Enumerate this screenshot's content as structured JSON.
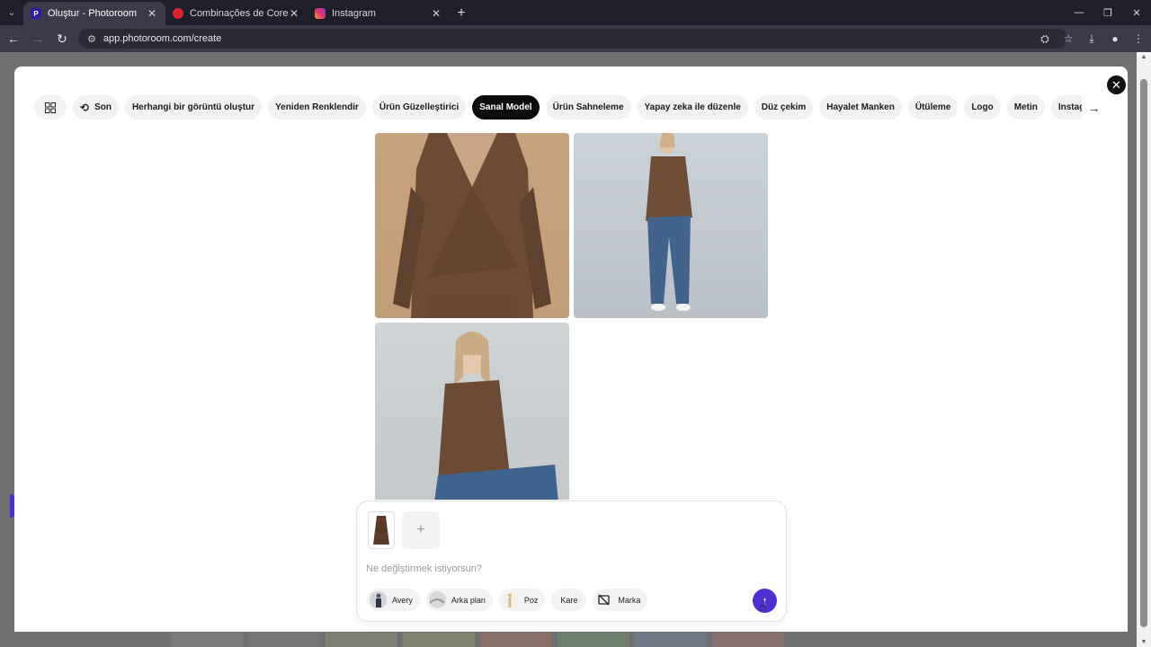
{
  "browser": {
    "tabs": [
      {
        "title": "Oluştur - Photoroom",
        "favicon_color": "#2b1fa0",
        "active": true
      },
      {
        "title": "Combinações de Cores - Outo",
        "favicon_color": "#d8232a",
        "active": false
      },
      {
        "title": "Instagram",
        "favicon_color": "#e1306c",
        "active": false
      }
    ],
    "url": "app.photoroom.com/create"
  },
  "modal": {
    "close_label": "✕",
    "chips": [
      {
        "label": "",
        "icon": "grid-icon",
        "active": false
      },
      {
        "label": "Son",
        "icon": "history-icon",
        "active": false
      },
      {
        "label": "Herhangi bir görüntü oluştur",
        "active": false
      },
      {
        "label": "Yeniden Renklendir",
        "active": false
      },
      {
        "label": "Ürün Güzelleştirici",
        "active": false
      },
      {
        "label": "Sanal Model",
        "active": true
      },
      {
        "label": "Ürün Sahneleme",
        "active": false
      },
      {
        "label": "Yapay zeka ile düzenle",
        "active": false
      },
      {
        "label": "Düz çekim",
        "active": false
      },
      {
        "label": "Hayalet Manken",
        "active": false
      },
      {
        "label": "Ütüleme",
        "active": false
      },
      {
        "label": "Logo",
        "active": false
      },
      {
        "label": "Metin",
        "active": false
      },
      {
        "label": "Instagram Hikayesi",
        "active": false
      }
    ],
    "chips_next_icon": "arrow-right-icon",
    "gallery": [
      {
        "name": "model-front-closeup",
        "tone": "#c7a27e"
      },
      {
        "name": "model-full-standing",
        "tone": "#c4cbd1"
      },
      {
        "name": "model-seated",
        "tone": "#cdd2d4"
      }
    ]
  },
  "prompt": {
    "placeholder": "Ne değiştirmek istiyorsun?",
    "value": "",
    "add_label": "+",
    "options": [
      {
        "label": "Avery",
        "icon": "avatar-icon"
      },
      {
        "label": "Arka plan",
        "icon": "background-icon"
      },
      {
        "label": "Poz",
        "icon": "pose-icon"
      },
      {
        "label": "Kare",
        "icon": ""
      },
      {
        "label": "Marka",
        "icon": "brand-off-icon"
      }
    ],
    "send_icon": "arrow-up-icon",
    "accent": "#4f2fcf"
  }
}
